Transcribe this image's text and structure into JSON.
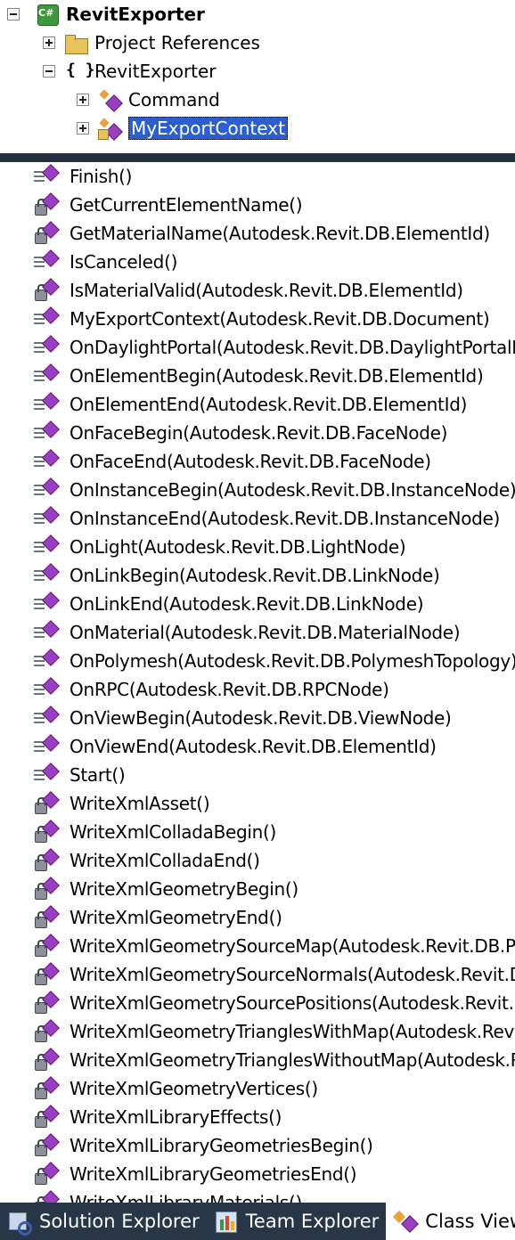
{
  "tree": {
    "root": {
      "label": "RevitExporter",
      "badge": "C#"
    },
    "items": [
      {
        "label": "Project References"
      },
      {
        "label": "RevitExporter",
        "glyph": "{ }"
      },
      {
        "label": "Command"
      },
      {
        "label": "MyExportContext"
      }
    ]
  },
  "members": [
    {
      "label": "Finish()",
      "access": "public"
    },
    {
      "label": "GetCurrentElementName()",
      "access": "private"
    },
    {
      "label": "GetMaterialName(Autodesk.Revit.DB.ElementId)",
      "access": "private"
    },
    {
      "label": "IsCanceled()",
      "access": "public"
    },
    {
      "label": "IsMaterialValid(Autodesk.Revit.DB.ElementId)",
      "access": "private"
    },
    {
      "label": "MyExportContext(Autodesk.Revit.DB.Document)",
      "access": "public"
    },
    {
      "label": "OnDaylightPortal(Autodesk.Revit.DB.DaylightPortalNode)",
      "access": "public"
    },
    {
      "label": "OnElementBegin(Autodesk.Revit.DB.ElementId)",
      "access": "public"
    },
    {
      "label": "OnElementEnd(Autodesk.Revit.DB.ElementId)",
      "access": "public"
    },
    {
      "label": "OnFaceBegin(Autodesk.Revit.DB.FaceNode)",
      "access": "public"
    },
    {
      "label": "OnFaceEnd(Autodesk.Revit.DB.FaceNode)",
      "access": "public"
    },
    {
      "label": "OnInstanceBegin(Autodesk.Revit.DB.InstanceNode)",
      "access": "public"
    },
    {
      "label": "OnInstanceEnd(Autodesk.Revit.DB.InstanceNode)",
      "access": "public"
    },
    {
      "label": "OnLight(Autodesk.Revit.DB.LightNode)",
      "access": "public"
    },
    {
      "label": "OnLinkBegin(Autodesk.Revit.DB.LinkNode)",
      "access": "public"
    },
    {
      "label": "OnLinkEnd(Autodesk.Revit.DB.LinkNode)",
      "access": "public"
    },
    {
      "label": "OnMaterial(Autodesk.Revit.DB.MaterialNode)",
      "access": "public"
    },
    {
      "label": "OnPolymesh(Autodesk.Revit.DB.PolymeshTopology)",
      "access": "public"
    },
    {
      "label": "OnRPC(Autodesk.Revit.DB.RPCNode)",
      "access": "public"
    },
    {
      "label": "OnViewBegin(Autodesk.Revit.DB.ViewNode)",
      "access": "public"
    },
    {
      "label": "OnViewEnd(Autodesk.Revit.DB.ElementId)",
      "access": "public"
    },
    {
      "label": "Start()",
      "access": "public"
    },
    {
      "label": "WriteXmlAsset()",
      "access": "private"
    },
    {
      "label": "WriteXmlColladaBegin()",
      "access": "private"
    },
    {
      "label": "WriteXmlColladaEnd()",
      "access": "private"
    },
    {
      "label": "WriteXmlGeometryBegin()",
      "access": "private"
    },
    {
      "label": "WriteXmlGeometryEnd()",
      "access": "private"
    },
    {
      "label": "WriteXmlGeometrySourceMap(Autodesk.Revit.DB.Po",
      "access": "private"
    },
    {
      "label": "WriteXmlGeometrySourceNormals(Autodesk.Revit.D",
      "access": "private"
    },
    {
      "label": "WriteXmlGeometrySourcePositions(Autodesk.Revit.D",
      "access": "private"
    },
    {
      "label": "WriteXmlGeometryTrianglesWithMap(Autodesk.Revit",
      "access": "private"
    },
    {
      "label": "WriteXmlGeometryTrianglesWithoutMap(Autodesk.R",
      "access": "private"
    },
    {
      "label": "WriteXmlGeometryVertices()",
      "access": "private"
    },
    {
      "label": "WriteXmlLibraryEffects()",
      "access": "private"
    },
    {
      "label": "WriteXmlLibraryGeometriesBegin()",
      "access": "private"
    },
    {
      "label": "WriteXmlLibraryGeometriesEnd()",
      "access": "private"
    },
    {
      "label": "WriteXmlLibraryMaterials()",
      "access": "private"
    }
  ],
  "tabs": [
    {
      "label": "Solution Explorer",
      "icon": "solution-explorer-icon"
    },
    {
      "label": "Team Explorer",
      "icon": "team-explorer-icon"
    },
    {
      "label": "Class View",
      "icon": "class-view-icon",
      "active": true
    }
  ],
  "colors": {
    "selection": "#2b5fd1",
    "tab_bar": "#283748",
    "splitter": "#24303f",
    "method_icon": "#9b3fc2"
  }
}
